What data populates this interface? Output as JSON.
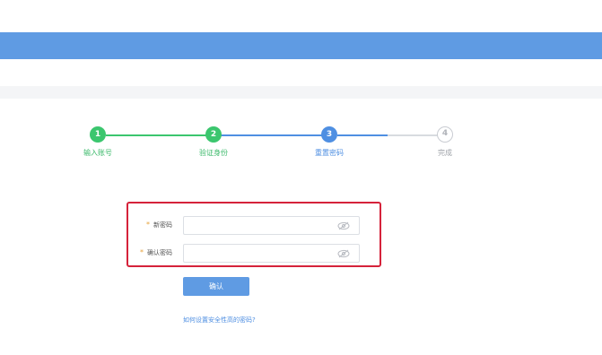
{
  "steps": [
    {
      "number": "1",
      "label": "输入账号",
      "state": "done"
    },
    {
      "number": "2",
      "label": "验证身份",
      "state": "done"
    },
    {
      "number": "3",
      "label": "重置密码",
      "state": "active"
    },
    {
      "number": "4",
      "label": "完成",
      "state": "pending"
    }
  ],
  "form": {
    "new_password_label": "新密码",
    "confirm_password_label": "确认密码",
    "required_mark": "*",
    "new_password_value": "",
    "confirm_password_value": ""
  },
  "confirm_button": "确认",
  "help_link": "如何设置安全性高的密码?",
  "colors": {
    "done": "#3bc66e",
    "active": "#4f8fe2",
    "header": "#5f9be3",
    "highlight": "#d5223a"
  }
}
